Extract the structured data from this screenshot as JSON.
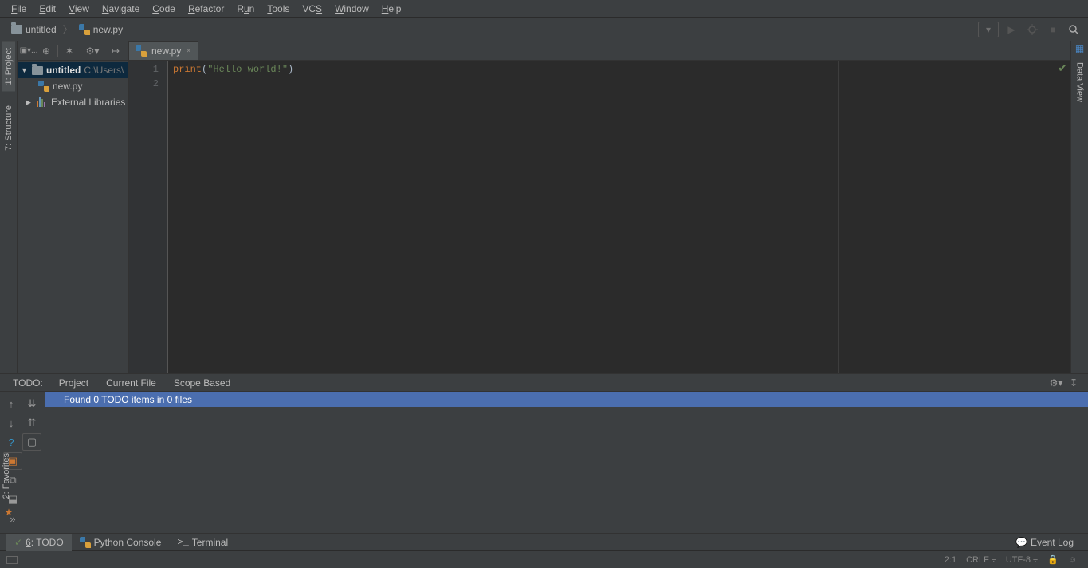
{
  "menu": {
    "file": "File",
    "edit": "Edit",
    "view": "View",
    "navigate": "Navigate",
    "code": "Code",
    "refactor": "Refactor",
    "run": "Run",
    "tools": "Tools",
    "vcs": "VCS",
    "window": "Window",
    "help": "Help"
  },
  "breadcrumb": {
    "project": "untitled",
    "file": "new.py"
  },
  "sidebar": {
    "project_tab": "1: Project",
    "structure_tab": "7: Structure",
    "root_name": "untitled",
    "root_path": "C:\\Users\\",
    "file": "new.py",
    "external": "External Libraries"
  },
  "editor": {
    "tab": "new.py",
    "line1_kw": "print",
    "line1_p1": "(",
    "line1_str": "\"Hello world!\"",
    "line1_p2": ")",
    "gutter": [
      "1",
      "2"
    ]
  },
  "right_tab": "Data View",
  "todo": {
    "label": "TODO:",
    "tabs": [
      "Project",
      "Current File",
      "Scope Based"
    ],
    "message": "Found 0 TODO items in 0 files"
  },
  "bottom": {
    "todo": "6: TODO",
    "console": "Python Console",
    "terminal": "Terminal",
    "eventlog": "Event Log"
  },
  "favorites_tab": "2: Favorites",
  "status": {
    "pos": "2:1",
    "eol": "CRLF",
    "eol_suffix": "÷",
    "enc": "UTF-8",
    "enc_suffix": "÷"
  }
}
